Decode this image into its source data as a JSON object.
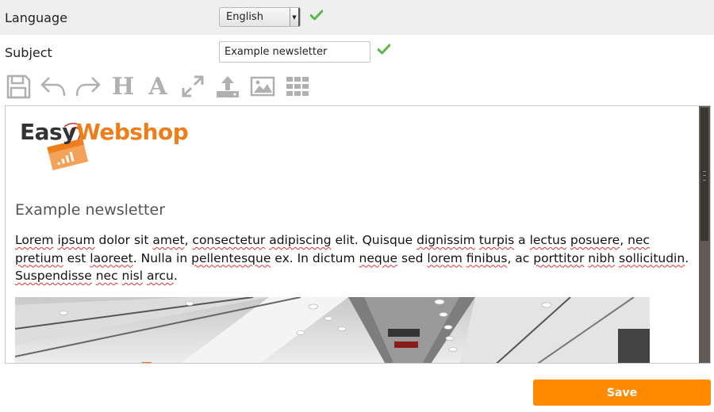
{
  "form": {
    "language": {
      "label": "Language",
      "selected": "English"
    },
    "subject": {
      "label": "Subject",
      "value": "Example newsletter"
    }
  },
  "toolbar": {
    "icons": [
      "save-icon",
      "undo-icon",
      "redo-icon",
      "heading-icon",
      "font-icon",
      "fullscreen-icon",
      "upload-icon",
      "image-icon",
      "grid-icon"
    ],
    "heading_glyph": "H",
    "font_glyph": "A"
  },
  "editor": {
    "logo": {
      "part1": "Easy",
      "part2": "Webshop"
    },
    "title": "Example newsletter",
    "body_words": [
      "Lorem",
      " ",
      "ipsum",
      " dolor sit ",
      "amet",
      ", ",
      "consectetur",
      " ",
      "adipiscing",
      " elit. Quisque ",
      "dignissim",
      " ",
      "turpis",
      " a ",
      "lectus",
      " ",
      "posuere",
      ", ",
      "nec",
      " ",
      "pretium",
      " est ",
      "laoreet",
      ". Nulla in ",
      "pellentesque",
      " ex. In dictum ",
      "neque",
      " sed ",
      "lorem",
      " ",
      "finibus",
      ", ac ",
      "porttitor",
      " ",
      "nibh",
      " ",
      "sollicitudin",
      ". ",
      "Suspendisse",
      " ",
      "nec",
      " ",
      "nisl",
      " ",
      "arcu",
      "."
    ]
  },
  "actions": {
    "save_label": "Save"
  },
  "colors": {
    "accent": "#ff8a00",
    "check": "#58b947",
    "logo_orange": "#ef7d1a"
  }
}
